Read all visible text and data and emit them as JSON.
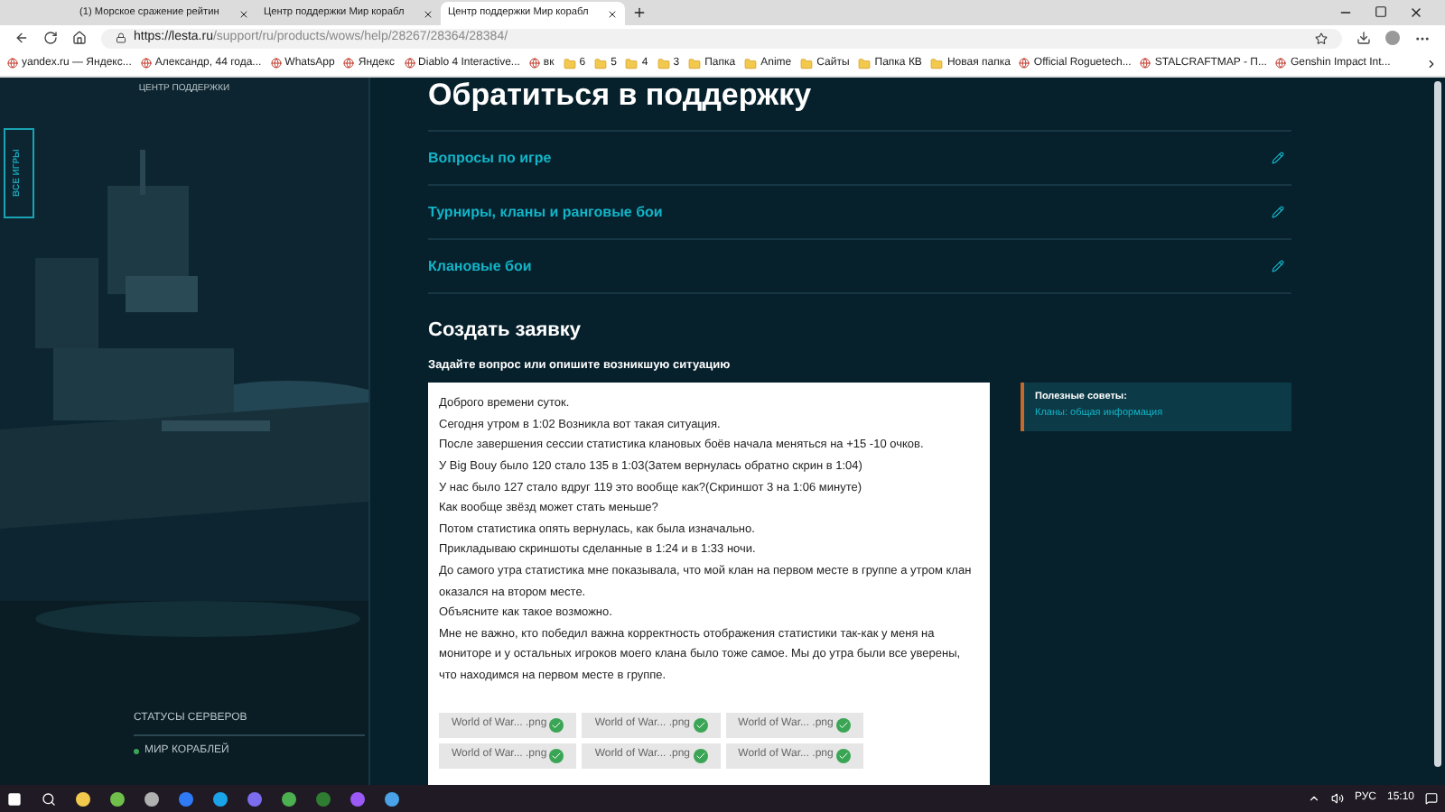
{
  "browser": {
    "tabs": [
      {
        "title": "(1) Морское сражение рейтин",
        "selected": false
      },
      {
        "title": "Центр поддержки Мир корабл",
        "selected": false
      },
      {
        "title": "Центр поддержки Мир корабл",
        "selected": true
      }
    ],
    "url_host": "https://lesta.ru",
    "url_path": "/support/ru/products/wows/help/28267/28364/28384/",
    "bookmarks": [
      {
        "label": "yandex.ru — Яндекс...",
        "kind": "site"
      },
      {
        "label": "Александр, 44 года...",
        "kind": "site"
      },
      {
        "label": "WhatsApp",
        "kind": "site"
      },
      {
        "label": "Яндекс",
        "kind": "site"
      },
      {
        "label": "Diablo 4 Interactive...",
        "kind": "site"
      },
      {
        "label": "вк",
        "kind": "site"
      },
      {
        "label": "6",
        "kind": "folder"
      },
      {
        "label": "5",
        "kind": "folder"
      },
      {
        "label": "4",
        "kind": "folder"
      },
      {
        "label": "3",
        "kind": "folder"
      },
      {
        "label": "Папка",
        "kind": "folder"
      },
      {
        "label": "Anime",
        "kind": "folder"
      },
      {
        "label": "Сайты",
        "kind": "folder"
      },
      {
        "label": "Папка КВ",
        "kind": "folder"
      },
      {
        "label": "Новая папка",
        "kind": "folder"
      },
      {
        "label": "Official Roguetech...",
        "kind": "site"
      },
      {
        "label": "STALCRAFTMAP - П...",
        "kind": "site"
      },
      {
        "label": "Genshin Impact Int...",
        "kind": "site"
      }
    ]
  },
  "sidebar": {
    "subtitle": "ЦЕНТР ПОДДЕРЖКИ",
    "all_games": "ВСЕ ИГРЫ",
    "status_heading": "СТАТУСЫ СЕРВЕРОВ",
    "servers": [
      {
        "name": "МИР КОРАБЛЕЙ",
        "color": "#3aa655"
      }
    ]
  },
  "main": {
    "title": "Обратиться в поддержку",
    "categories": [
      "Вопросы по игре",
      "Турниры, кланы и ранговые бои",
      "Клановые бои"
    ],
    "form_title": "Создать заявку",
    "form_label": "Задайте вопрос или опишите возникшую ситуацию",
    "message_lines": [
      "Доброго времени суток.",
      "Сегодня утром в 1:02 Возникла вот такая ситуация.",
      "После завершения сессии статистика клановых боёв начала меняться на +15 -10 очков.",
      "У Big Bouy было 120 стало 135 в 1:03(Затем вернулась обратно скрин в 1:04)",
      "У нас было 127 стало вдруг 119 это вообще как?(Скриншот 3 на 1:06 минуте)",
      "Как вообще звёзд может стать меньше?",
      "Потом статистика опять вернулась, как была изначально.",
      "Прикладываю скриншоты сделанные в 1:24 и в 1:33 ночи.",
      "До самого утра статистика мне показывала, что мой клан на первом месте в группе а утром клан оказался на втором месте.",
      "Объясните как такое возможно.",
      "Мне не важно, кто победил важна корректность отображения статистики так-как у меня на мониторе и у остальных игроков моего клана было тоже самое. Мы до утра были все уверены, что находимся на первом месте в группе."
    ],
    "attachments": [
      "World of War... .png",
      "World of War... .png",
      "World of War... .png",
      "World of War... .png",
      "World of War... .png",
      "World of War... .png"
    ],
    "tips_title": "Полезные советы:",
    "tips_link": "Кланы: общая информация"
  },
  "taskbar": {
    "language": "РУС",
    "time": "15:10"
  }
}
